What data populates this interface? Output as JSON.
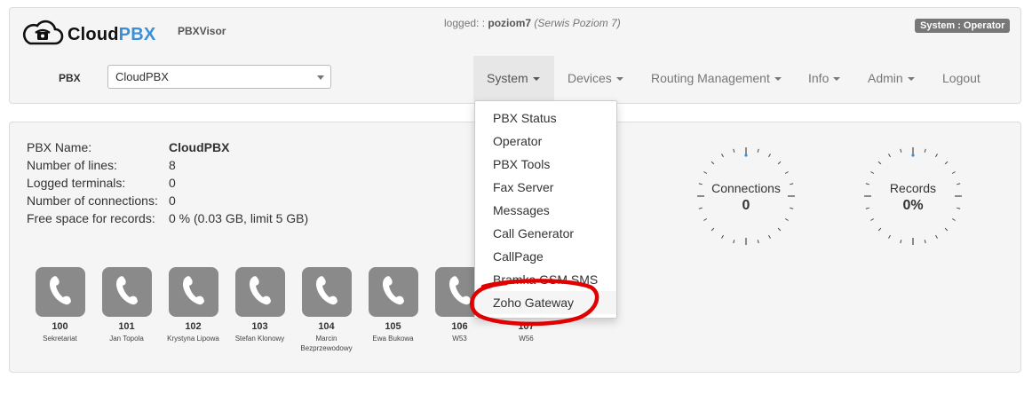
{
  "header": {
    "brand_part1": "Cloud",
    "brand_part2": "PBX",
    "app_name": "PBXVisor",
    "logged_prefix": "logged: :",
    "username": "poziom7",
    "user_desc": "(Serwis Poziom 7)",
    "role_badge": "System : Operator",
    "pbx_label": "PBX",
    "pbx_selected": "CloudPBX",
    "icon": "cloud-phone-icon"
  },
  "nav": {
    "items": [
      {
        "label": "System",
        "dropdown": true
      },
      {
        "label": "Devices",
        "dropdown": true
      },
      {
        "label": "Routing Management",
        "dropdown": true
      },
      {
        "label": "Info",
        "dropdown": true
      },
      {
        "label": "Admin",
        "dropdown": true
      },
      {
        "label": "Logout",
        "dropdown": false
      }
    ]
  },
  "system_menu": {
    "items": [
      "PBX Status",
      "Operator",
      "PBX Tools",
      "Fax Server",
      "Messages",
      "Call Generator",
      "CallPage",
      "Bramka GSM SMS",
      "Zoho Gateway"
    ],
    "highlight_color": "#e00000"
  },
  "pbx_info": {
    "rows": [
      {
        "key": "PBX Name:",
        "value": "CloudPBX"
      },
      {
        "key": "Number of lines:",
        "value": "8"
      },
      {
        "key": "Logged terminals:",
        "value": "0"
      },
      {
        "key": "Number of connections:",
        "value": "0"
      },
      {
        "key": "Free space for records:",
        "value": "0 % (0.03 GB, limit 5 GB)"
      }
    ]
  },
  "extensions": [
    {
      "number": "100",
      "name": "Sekretariat"
    },
    {
      "number": "101",
      "name": "Jan Topola"
    },
    {
      "number": "102",
      "name": "Krystyna Lipowa"
    },
    {
      "number": "103",
      "name": "Stefan Klonowy"
    },
    {
      "number": "104",
      "name": "Marcin Bezprzewodowy"
    },
    {
      "number": "105",
      "name": "Ewa Bukowa"
    },
    {
      "number": "106",
      "name": "W53"
    },
    {
      "number": "107",
      "name": "W56"
    }
  ],
  "gauges": [
    {
      "label": "Connections",
      "value": "0",
      "level": 0
    },
    {
      "label": "Records",
      "value": "0%",
      "level": 0
    }
  ],
  "colors": {
    "brand_blue": "#3a8fd8",
    "tile_gray": "#8a8a8a",
    "gauge_marker": "#3a8fd8"
  }
}
